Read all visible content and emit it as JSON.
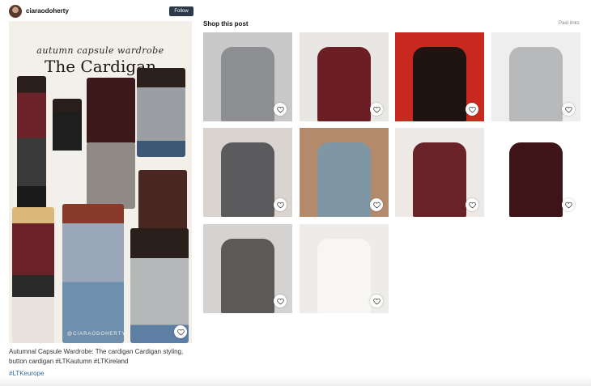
{
  "profile": {
    "username": "ciaraodoherty",
    "follow_label": "Follow"
  },
  "post": {
    "image_title_script": "autumn capsule wardrobe",
    "image_title": "The Cardigan",
    "image_watermark": "@CIARAODOHERTY",
    "caption": "Autumnal Capsule Wardrobe: The cardigan Cardigan styling, button cardigan #LTKautumn #LTKireland",
    "hashtag": "#LTKeurope"
  },
  "shop": {
    "title": "Shop this post",
    "paid_links_label": "Paid links",
    "products": [
      {
        "name": "grey-cardigan-jeans",
        "bg": "#c8c8c8",
        "main": "#8c8e92"
      },
      {
        "name": "burgundy-cardigan-bag",
        "bg": "#e9e7e4",
        "main": "#6b1f25"
      },
      {
        "name": "red-knit-closeup",
        "bg": "#c8281e",
        "main": "#1f1411"
      },
      {
        "name": "light-grey-cardigan",
        "bg": "#eeeeee",
        "main": "#b7b9ba"
      },
      {
        "name": "charcoal-cardigan-set",
        "bg": "#d9d4cf",
        "main": "#5b5a5c"
      },
      {
        "name": "blue-grey-cardigan-seated",
        "bg": "#b48a6d",
        "main": "#7f97a4"
      },
      {
        "name": "burgundy-cardigan-tote",
        "bg": "#ece9e6",
        "main": "#6a2229"
      },
      {
        "name": "burgundy-cardigan-flat",
        "bg": "#ffffff",
        "main": "#3e1418"
      },
      {
        "name": "grey-knit-sunglasses",
        "bg": "#d4d3d1",
        "main": "#5c5a57"
      },
      {
        "name": "white-cardigan-flat",
        "bg": "#eeece9",
        "main": "#f7f6f3"
      }
    ]
  },
  "colors": {
    "follow_bg": "#2b3a4a",
    "hashtag": "#2d6a9a"
  }
}
